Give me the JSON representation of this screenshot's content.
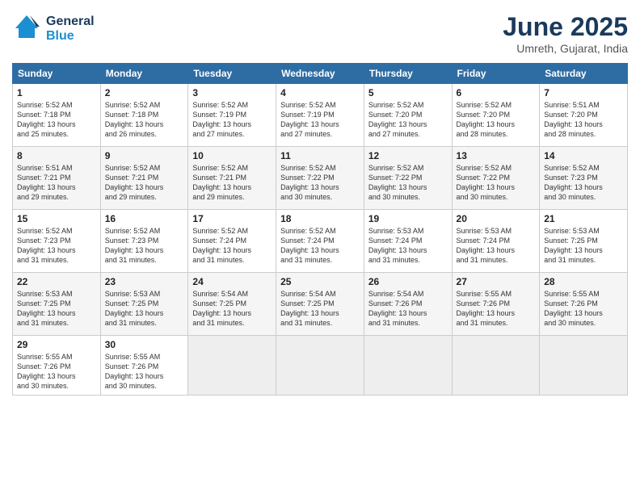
{
  "header": {
    "logo_line1": "General",
    "logo_line2": "Blue",
    "month_title": "June 2025",
    "location": "Umreth, Gujarat, India"
  },
  "weekdays": [
    "Sunday",
    "Monday",
    "Tuesday",
    "Wednesday",
    "Thursday",
    "Friday",
    "Saturday"
  ],
  "weeks": [
    [
      {
        "day": "1",
        "info": "Sunrise: 5:52 AM\nSunset: 7:18 PM\nDaylight: 13 hours\nand 25 minutes."
      },
      {
        "day": "2",
        "info": "Sunrise: 5:52 AM\nSunset: 7:18 PM\nDaylight: 13 hours\nand 26 minutes."
      },
      {
        "day": "3",
        "info": "Sunrise: 5:52 AM\nSunset: 7:19 PM\nDaylight: 13 hours\nand 27 minutes."
      },
      {
        "day": "4",
        "info": "Sunrise: 5:52 AM\nSunset: 7:19 PM\nDaylight: 13 hours\nand 27 minutes."
      },
      {
        "day": "5",
        "info": "Sunrise: 5:52 AM\nSunset: 7:20 PM\nDaylight: 13 hours\nand 27 minutes."
      },
      {
        "day": "6",
        "info": "Sunrise: 5:52 AM\nSunset: 7:20 PM\nDaylight: 13 hours\nand 28 minutes."
      },
      {
        "day": "7",
        "info": "Sunrise: 5:51 AM\nSunset: 7:20 PM\nDaylight: 13 hours\nand 28 minutes."
      }
    ],
    [
      {
        "day": "8",
        "info": "Sunrise: 5:51 AM\nSunset: 7:21 PM\nDaylight: 13 hours\nand 29 minutes."
      },
      {
        "day": "9",
        "info": "Sunrise: 5:52 AM\nSunset: 7:21 PM\nDaylight: 13 hours\nand 29 minutes."
      },
      {
        "day": "10",
        "info": "Sunrise: 5:52 AM\nSunset: 7:21 PM\nDaylight: 13 hours\nand 29 minutes."
      },
      {
        "day": "11",
        "info": "Sunrise: 5:52 AM\nSunset: 7:22 PM\nDaylight: 13 hours\nand 30 minutes."
      },
      {
        "day": "12",
        "info": "Sunrise: 5:52 AM\nSunset: 7:22 PM\nDaylight: 13 hours\nand 30 minutes."
      },
      {
        "day": "13",
        "info": "Sunrise: 5:52 AM\nSunset: 7:22 PM\nDaylight: 13 hours\nand 30 minutes."
      },
      {
        "day": "14",
        "info": "Sunrise: 5:52 AM\nSunset: 7:23 PM\nDaylight: 13 hours\nand 30 minutes."
      }
    ],
    [
      {
        "day": "15",
        "info": "Sunrise: 5:52 AM\nSunset: 7:23 PM\nDaylight: 13 hours\nand 31 minutes."
      },
      {
        "day": "16",
        "info": "Sunrise: 5:52 AM\nSunset: 7:23 PM\nDaylight: 13 hours\nand 31 minutes."
      },
      {
        "day": "17",
        "info": "Sunrise: 5:52 AM\nSunset: 7:24 PM\nDaylight: 13 hours\nand 31 minutes."
      },
      {
        "day": "18",
        "info": "Sunrise: 5:52 AM\nSunset: 7:24 PM\nDaylight: 13 hours\nand 31 minutes."
      },
      {
        "day": "19",
        "info": "Sunrise: 5:53 AM\nSunset: 7:24 PM\nDaylight: 13 hours\nand 31 minutes."
      },
      {
        "day": "20",
        "info": "Sunrise: 5:53 AM\nSunset: 7:24 PM\nDaylight: 13 hours\nand 31 minutes."
      },
      {
        "day": "21",
        "info": "Sunrise: 5:53 AM\nSunset: 7:25 PM\nDaylight: 13 hours\nand 31 minutes."
      }
    ],
    [
      {
        "day": "22",
        "info": "Sunrise: 5:53 AM\nSunset: 7:25 PM\nDaylight: 13 hours\nand 31 minutes."
      },
      {
        "day": "23",
        "info": "Sunrise: 5:53 AM\nSunset: 7:25 PM\nDaylight: 13 hours\nand 31 minutes."
      },
      {
        "day": "24",
        "info": "Sunrise: 5:54 AM\nSunset: 7:25 PM\nDaylight: 13 hours\nand 31 minutes."
      },
      {
        "day": "25",
        "info": "Sunrise: 5:54 AM\nSunset: 7:25 PM\nDaylight: 13 hours\nand 31 minutes."
      },
      {
        "day": "26",
        "info": "Sunrise: 5:54 AM\nSunset: 7:26 PM\nDaylight: 13 hours\nand 31 minutes."
      },
      {
        "day": "27",
        "info": "Sunrise: 5:55 AM\nSunset: 7:26 PM\nDaylight: 13 hours\nand 31 minutes."
      },
      {
        "day": "28",
        "info": "Sunrise: 5:55 AM\nSunset: 7:26 PM\nDaylight: 13 hours\nand 30 minutes."
      }
    ],
    [
      {
        "day": "29",
        "info": "Sunrise: 5:55 AM\nSunset: 7:26 PM\nDaylight: 13 hours\nand 30 minutes."
      },
      {
        "day": "30",
        "info": "Sunrise: 5:55 AM\nSunset: 7:26 PM\nDaylight: 13 hours\nand 30 minutes."
      },
      {
        "day": "",
        "info": ""
      },
      {
        "day": "",
        "info": ""
      },
      {
        "day": "",
        "info": ""
      },
      {
        "day": "",
        "info": ""
      },
      {
        "day": "",
        "info": ""
      }
    ]
  ]
}
